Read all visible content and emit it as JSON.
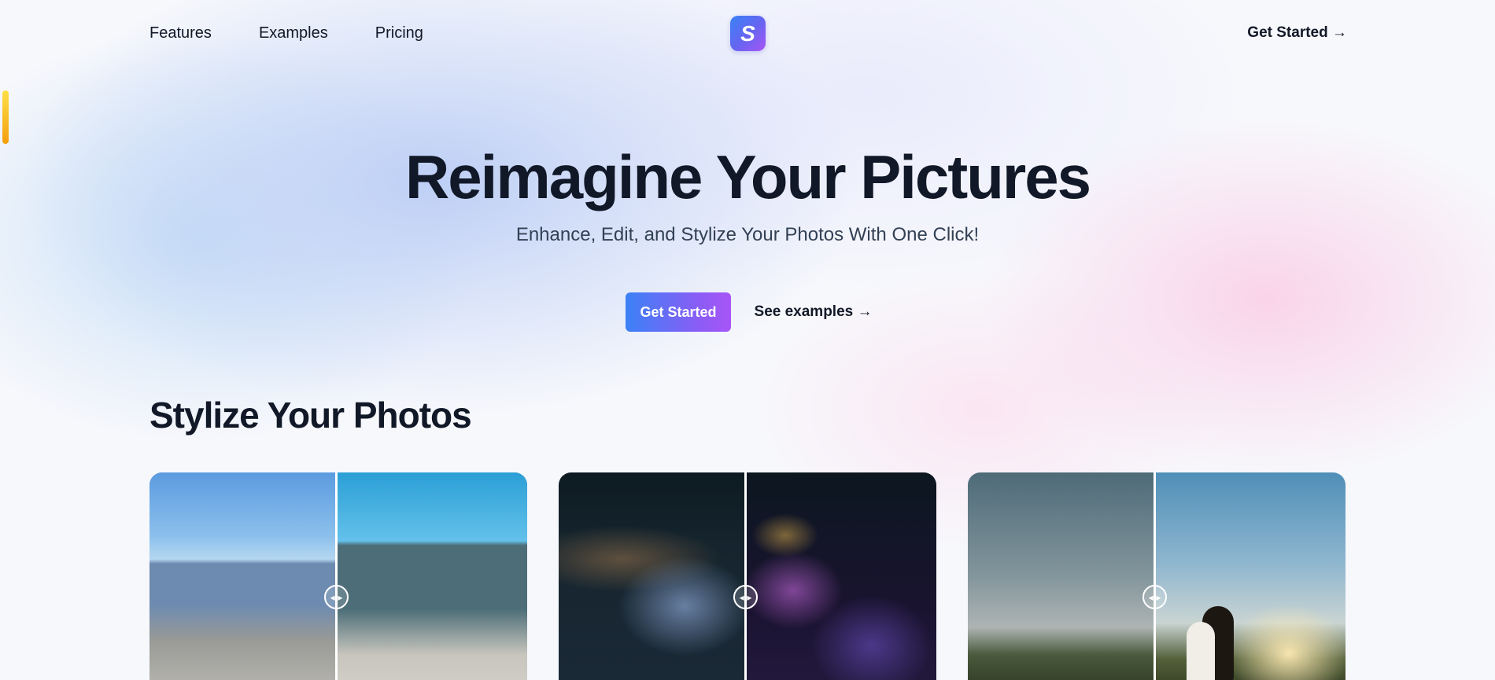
{
  "nav": {
    "items": [
      "Features",
      "Examples",
      "Pricing"
    ],
    "logo_letter": "S",
    "cta": "Get Started →"
  },
  "hero": {
    "title": "Reimagine Your Pictures",
    "subtitle": "Enhance, Edit, and Stylize Your Photos With One Click!",
    "primary_button": "Get Started",
    "secondary_link": "See examples →"
  },
  "section": {
    "title": "Stylize Your Photos",
    "handle_glyph": "◂ ▸"
  },
  "colors": {
    "brand_gradient_start": "#3b82f6",
    "brand_gradient_end": "#a855f7",
    "text_primary": "#111827"
  }
}
